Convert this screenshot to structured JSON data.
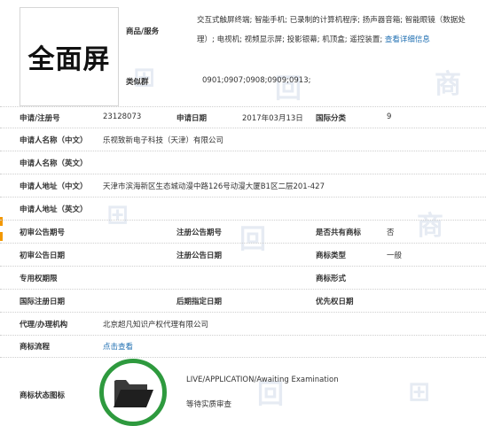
{
  "trademark": {
    "logo_text": "全面屏",
    "goods_services_label": "商品/服务",
    "goods_services": "交互式触屏终端; 智能手机; 已录制的计算机程序; 扬声器音箱; 智能眼镜（数据处理）; 电视机; 视频显示屏; 投影银幕; 机顶盒; 遥控装置;",
    "view_details": "查看详细信息",
    "similar_group_label": "类似群",
    "similar_group": "0901;0907;0908;0909;0913;"
  },
  "fields": {
    "reg_no_label": "申请/注册号",
    "reg_no": "23128073",
    "app_date_label": "申请日期",
    "app_date": "2017年03月13日",
    "intl_class_label": "国际分类",
    "intl_class": "9",
    "applicant_cn_label": "申请人名称（中文）",
    "applicant_cn": "乐视致新电子科技（天津）有限公司",
    "applicant_en_label": "申请人名称（英文）",
    "address_cn_label": "申请人地址（中文）",
    "address_cn": "天津市滨海新区生态城动漫中路126号动漫大厦B1区二层201-427",
    "address_en_label": "申请人地址（英文）",
    "prelim_pub_no_label": "初审公告期号",
    "reg_pub_no_label": "注册公告期号",
    "shared_label": "是否共有商标",
    "shared": "否",
    "prelim_pub_date_label": "初审公告日期",
    "reg_pub_date_label": "注册公告日期",
    "tm_type_label": "商标类型",
    "tm_type": "一般",
    "exclusive_period_label": "专用权期限",
    "tm_form_label": "商标形式",
    "intl_reg_date_label": "国际注册日期",
    "later_designation_label": "后期指定日期",
    "priority_date_label": "优先权日期",
    "agent_label": "代理/办理机构",
    "agent": "北京超凡知识产权代理有限公司",
    "process_label": "商标流程",
    "process_link": "点击查看",
    "status_icon_label": "商标状态图标",
    "status_en": "LIVE/APPLICATION/Awaiting Examination",
    "status_cn": "等待实质审查"
  },
  "colors": {
    "link": "#1f6fb2",
    "status_ring": "#2e9a3e",
    "side_marker": "#f39800"
  },
  "icons": {
    "status": "folder-icon"
  }
}
